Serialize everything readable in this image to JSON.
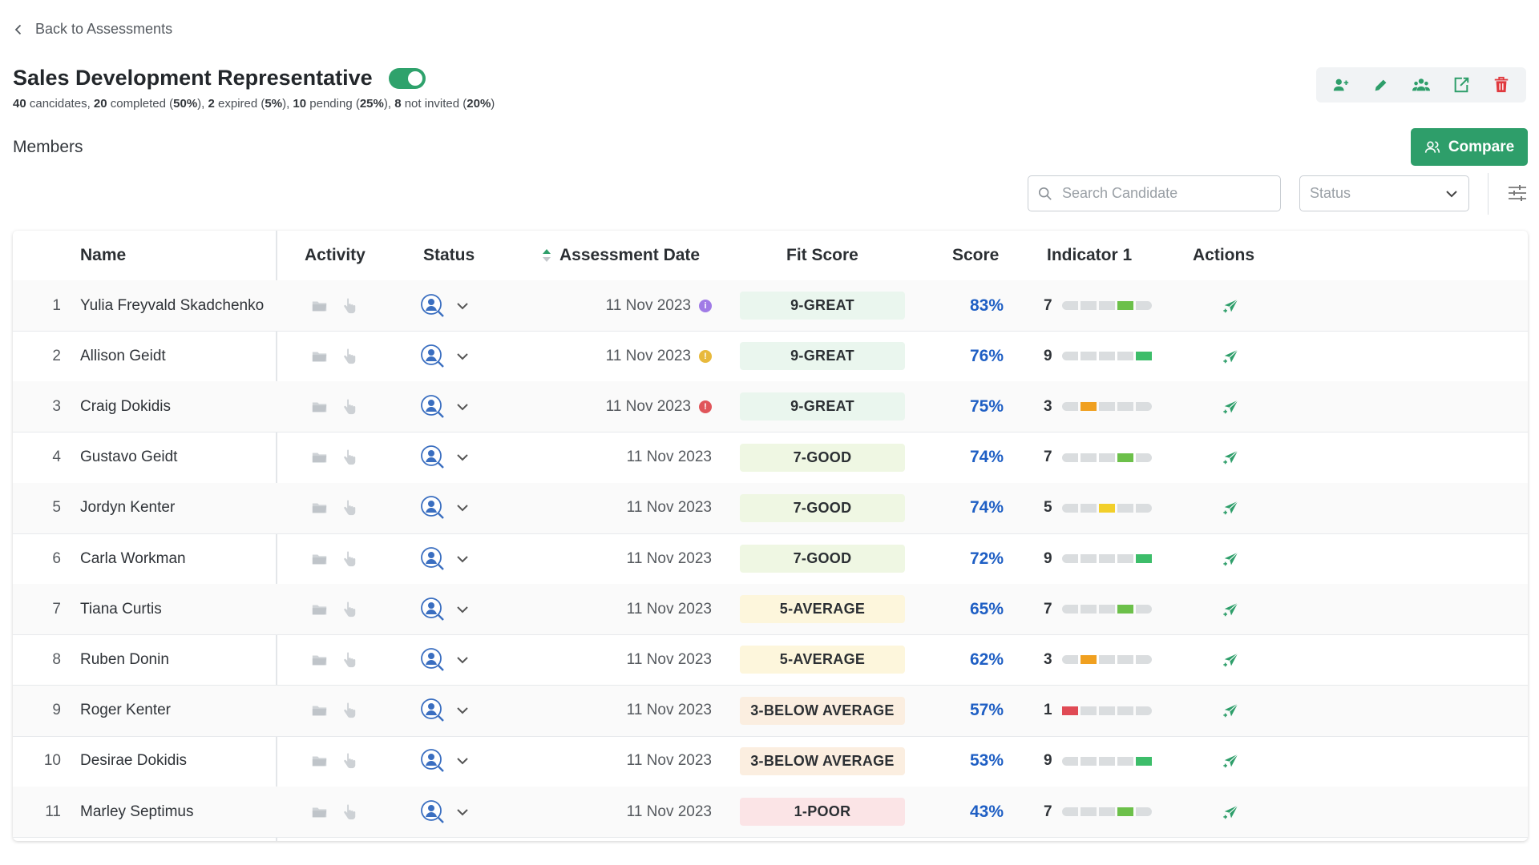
{
  "back_label": "Back to Assessments",
  "assessment": {
    "title": "Sales Development Representative",
    "active": true,
    "summary": [
      {
        "n": "40",
        "t": " cancidates, "
      },
      {
        "n": "20",
        "t": " completed ("
      },
      {
        "n": "50%",
        "t": "), "
      },
      {
        "n": "2",
        "t": " expired ("
      },
      {
        "n": "5%",
        "t": "), "
      },
      {
        "n": "10",
        "t": " pending ("
      },
      {
        "n": "25%",
        "t": "), "
      },
      {
        "n": "8",
        "t": " not invited ("
      },
      {
        "n": "20%",
        "t": ")"
      }
    ]
  },
  "toolbar_icons": [
    "add-candidate-icon",
    "edit-icon",
    "group-icon",
    "export-icon",
    "delete-icon"
  ],
  "members_label": "Members",
  "compare_label": "Compare",
  "search": {
    "placeholder": "Search Candidate"
  },
  "status_filter": {
    "placeholder": "Status"
  },
  "colors": {
    "accent": "#2e9e6a",
    "score_blue": "#1f5fc4",
    "delete_red": "#e0393e",
    "great_bg": "#eaf6ee",
    "good_bg": "#eff7e3",
    "average_bg": "#fdf6dc",
    "below_bg": "#fbeee0",
    "poor_bg": "#fbe4e6"
  },
  "columns": {
    "name": "Name",
    "activity": "Activity",
    "status": "Status",
    "date": "Assessment Date",
    "fit": "Fit Score",
    "score": "Score",
    "indicator": "Indicator 1",
    "actions": "Actions"
  },
  "rows": [
    {
      "num": "1",
      "name": "Yulia Freyvald Skadchenko",
      "date": "11 Nov 2023",
      "flag": "purple",
      "fit": "9-GREAT",
      "fit_level": "great",
      "score": "83%",
      "indicator": "7",
      "ind_color": "#6cc04a"
    },
    {
      "num": "2",
      "name": "Allison Geidt",
      "date": "11 Nov 2023",
      "flag": "yellow",
      "fit": "9-GREAT",
      "fit_level": "great",
      "score": "76%",
      "indicator": "9",
      "ind_color": "#3dbd6a"
    },
    {
      "num": "3",
      "name": "Craig Dokidis",
      "date": "11 Nov 2023",
      "flag": "red",
      "fit": "9-GREAT",
      "fit_level": "great",
      "score": "75%",
      "indicator": "3",
      "ind_color": "#f0a020"
    },
    {
      "num": "4",
      "name": "Gustavo Geidt",
      "date": "11 Nov 2023",
      "flag": "",
      "fit": "7-GOOD",
      "fit_level": "good",
      "score": "74%",
      "indicator": "7",
      "ind_color": "#6cc04a"
    },
    {
      "num": "5",
      "name": "Jordyn Kenter",
      "date": "11 Nov 2023",
      "flag": "",
      "fit": "7-GOOD",
      "fit_level": "good",
      "score": "74%",
      "indicator": "5",
      "ind_color": "#f2cf2a"
    },
    {
      "num": "6",
      "name": "Carla Workman",
      "date": "11 Nov 2023",
      "flag": "",
      "fit": "7-GOOD",
      "fit_level": "good",
      "score": "72%",
      "indicator": "9",
      "ind_color": "#3dbd6a"
    },
    {
      "num": "7",
      "name": "Tiana Curtis",
      "date": "11 Nov 2023",
      "flag": "",
      "fit": "5-AVERAGE",
      "fit_level": "average",
      "score": "65%",
      "indicator": "7",
      "ind_color": "#6cc04a"
    },
    {
      "num": "8",
      "name": "Ruben Donin",
      "date": "11 Nov 2023",
      "flag": "",
      "fit": "5-AVERAGE",
      "fit_level": "average",
      "score": "62%",
      "indicator": "3",
      "ind_color": "#f0a020"
    },
    {
      "num": "9",
      "name": "Roger Kenter",
      "date": "11 Nov 2023",
      "flag": "",
      "fit": "3-BELOW AVERAGE",
      "fit_level": "below",
      "score": "57%",
      "indicator": "1",
      "ind_color": "#e04a55"
    },
    {
      "num": "10",
      "name": "Desirae Dokidis",
      "date": "11 Nov 2023",
      "flag": "",
      "fit": "3-BELOW AVERAGE",
      "fit_level": "below",
      "score": "53%",
      "indicator": "9",
      "ind_color": "#3dbd6a"
    },
    {
      "num": "11",
      "name": "Marley Septimus",
      "date": "11 Nov 2023",
      "flag": "",
      "fit": "1-POOR",
      "fit_level": "poor",
      "score": "43%",
      "indicator": "7",
      "ind_color": "#6cc04a"
    }
  ]
}
